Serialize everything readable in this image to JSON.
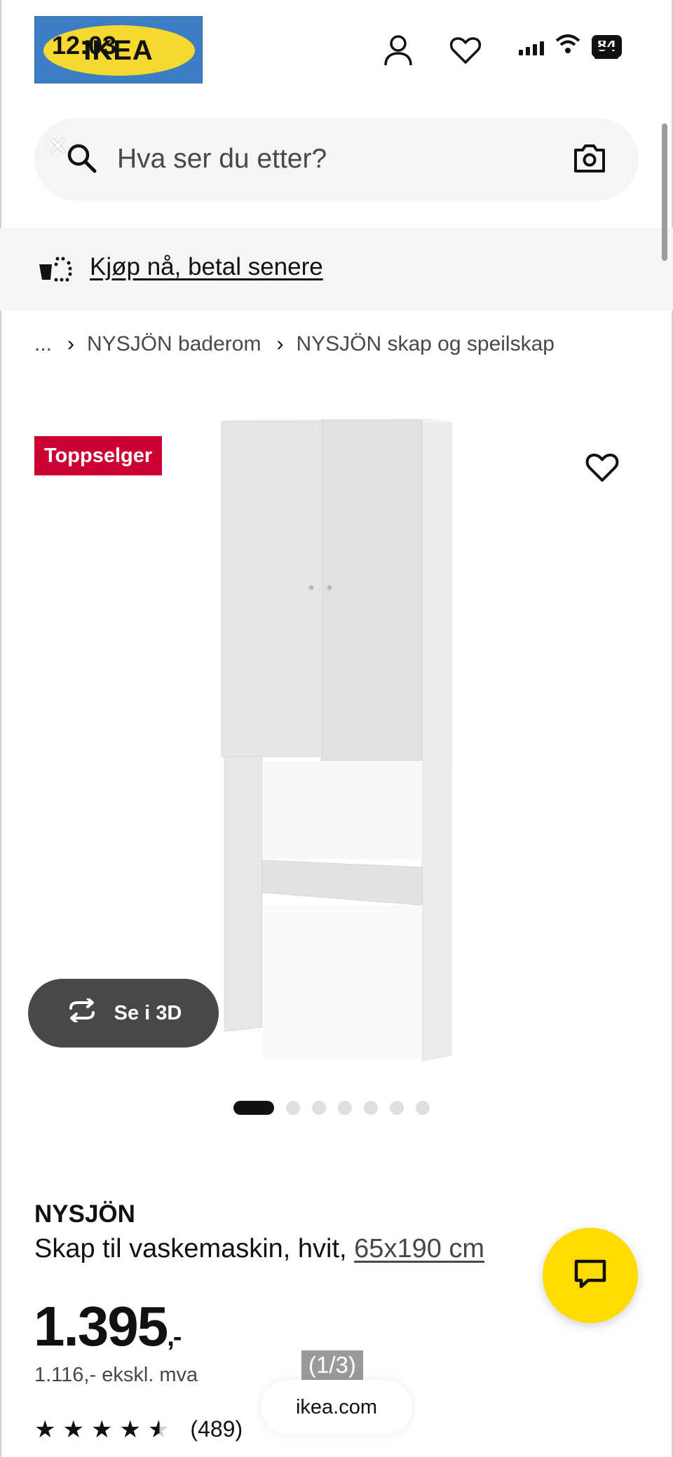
{
  "status_bar": {
    "time": "12:03",
    "battery": "84"
  },
  "header": {
    "logo_text": "IKEA",
    "icons": [
      "user-icon",
      "heart-icon",
      "menu-icon"
    ]
  },
  "search": {
    "placeholder": "Hva ser du etter?",
    "icons": [
      "close-icon",
      "search-icon",
      "camera-icon"
    ]
  },
  "promo": {
    "link_text": "Kjøp nå, betal senere"
  },
  "breadcrumb": {
    "items": [
      "...",
      "NYSJÖN baderom",
      "NYSJÖN skap og speilskap"
    ]
  },
  "gallery": {
    "badge": "Toppselger",
    "view_3d_label": "Se i 3D",
    "image_count": 7,
    "active_image_index": 0
  },
  "product": {
    "name": "NYSJÖN",
    "description": "Skap til vaskemaskin, hvit,",
    "size": "65x190 cm",
    "price": "1.395",
    "price_suffix": ",-",
    "price_ex_vat": "1.116,- ekskl. mva",
    "rating": 4.5,
    "rating_max": 5,
    "rating_count": "(489)"
  },
  "browser": {
    "page_counter": "(1/3)",
    "url": "ikea.com"
  },
  "colors": {
    "badge_bg": "#cc0033",
    "chat_bg": "#ffdb00",
    "pill_bg": "#f5f5f5",
    "button_dark": "#484848"
  }
}
